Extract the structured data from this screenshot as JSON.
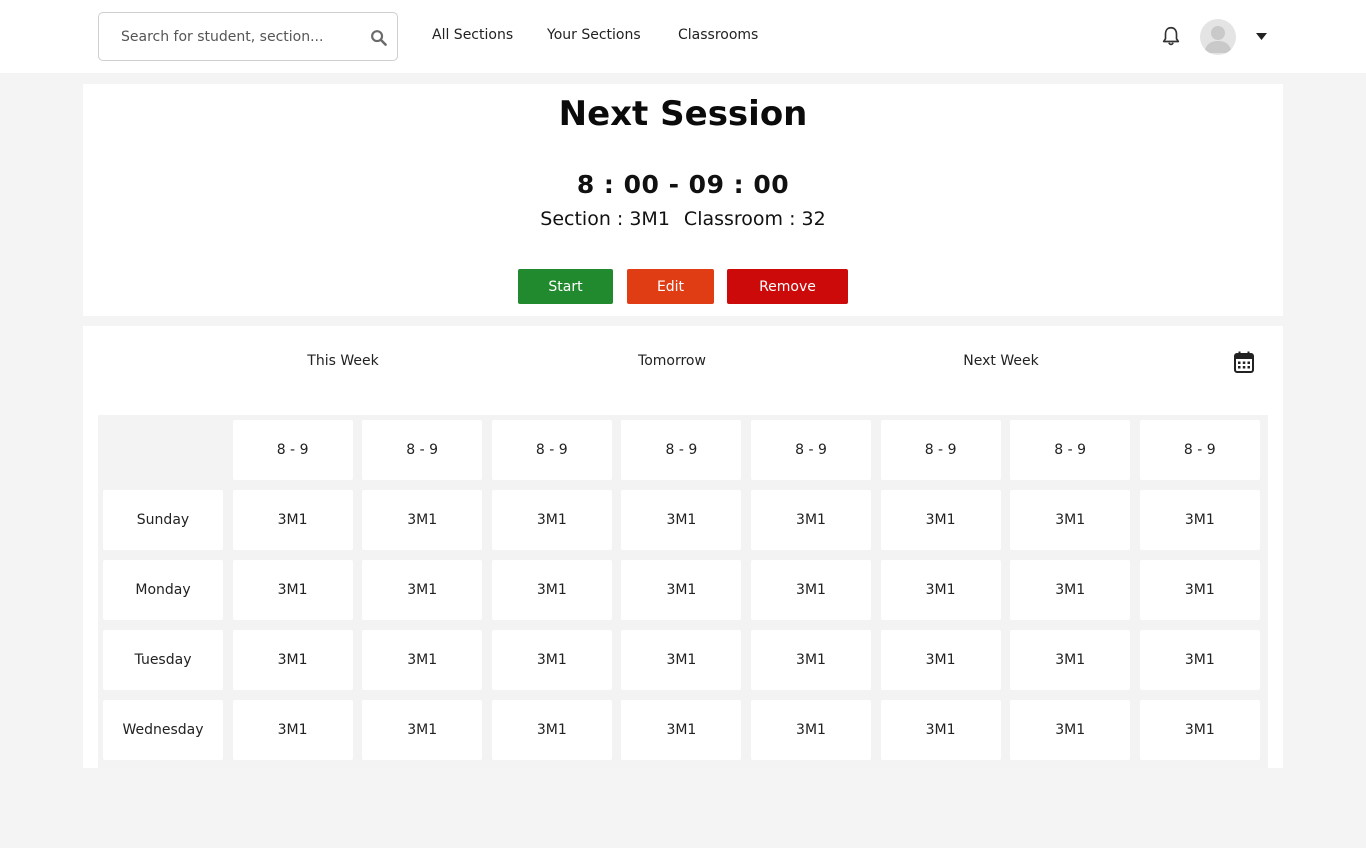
{
  "header": {
    "search_placeholder": "Search for student, section...",
    "icons": {
      "search": "search-icon",
      "notifications": "bell-icon",
      "account": "user-avatar-icon",
      "menu": "caret-down-icon"
    },
    "nav": [
      {
        "label": "All Sections"
      },
      {
        "label": "Your Sections"
      },
      {
        "label": "Classrooms"
      }
    ]
  },
  "next_session": {
    "title": "Next Session",
    "time": "8 : 00 - 09 : 00",
    "section": "Section : 3M1",
    "classroom": "Classroom : 32",
    "buttons": {
      "start": "Start",
      "edit": "Edit",
      "remove": "Remove"
    },
    "colors": {
      "start": "#228a2e",
      "edit": "#e03d15",
      "remove": "#cc0a0a"
    }
  },
  "schedule": {
    "tabs": [
      {
        "label": "This Week"
      },
      {
        "label": "Tomorrow"
      },
      {
        "label": "Next Week"
      }
    ],
    "calendar_icon": "calendar-icon",
    "time_slots": [
      "8 - 9",
      "8 - 9",
      "8 - 9",
      "8 - 9",
      "8 - 9",
      "8 - 9",
      "8 - 9",
      "8 - 9"
    ],
    "rows": [
      {
        "day": "Sunday",
        "cells": [
          "3M1",
          "3M1",
          "3M1",
          "3M1",
          "3M1",
          "3M1",
          "3M1",
          "3M1"
        ]
      },
      {
        "day": "Monday",
        "cells": [
          "3M1",
          "3M1",
          "3M1",
          "3M1",
          "3M1",
          "3M1",
          "3M1",
          "3M1"
        ]
      },
      {
        "day": "Tuesday",
        "cells": [
          "3M1",
          "3M1",
          "3M1",
          "3M1",
          "3M1",
          "3M1",
          "3M1",
          "3M1"
        ]
      },
      {
        "day": "Wednesday",
        "cells": [
          "3M1",
          "3M1",
          "3M1",
          "3M1",
          "3M1",
          "3M1",
          "3M1",
          "3M1"
        ]
      }
    ]
  }
}
